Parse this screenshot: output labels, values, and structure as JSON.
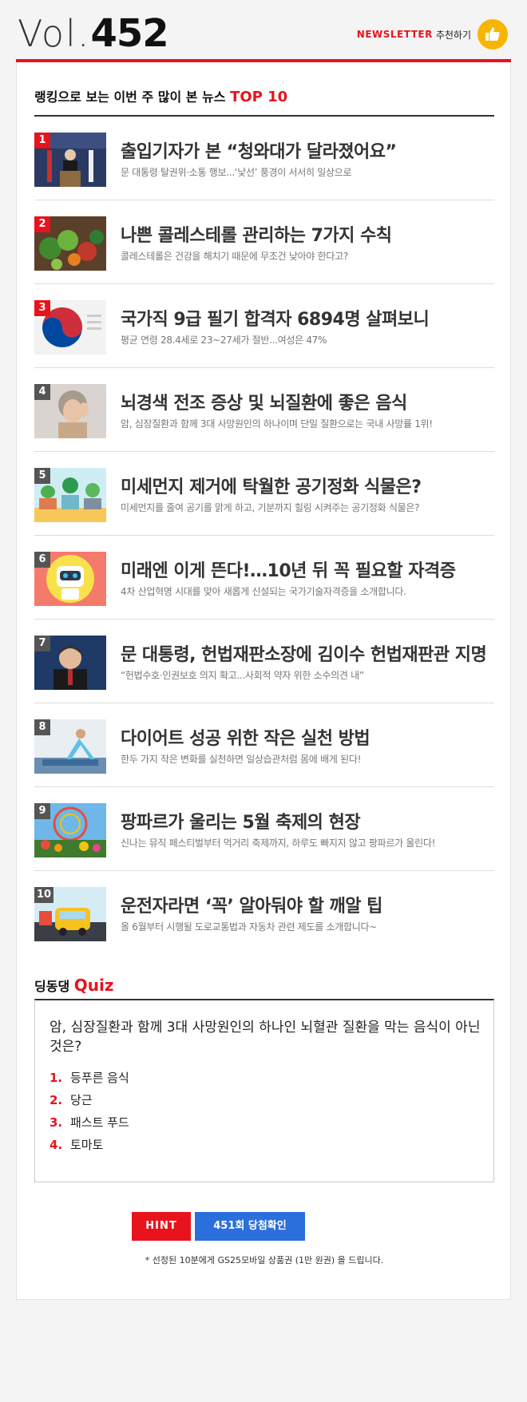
{
  "header": {
    "vol_label": "Vol.",
    "vol_number": "452",
    "newsletter_label": "NEWSLETTER",
    "recommend_label": "추천하기"
  },
  "ranking": {
    "title_prefix": "랭킹으로 보는 이번 주 많이 본 뉴스",
    "title_accent": "TOP 10",
    "items": [
      {
        "rank": "1",
        "title": "출입기자가 본 “청와대가 달라졌어요”",
        "subtitle": "문 대통령 탈권위·소통 행보...‘낯선’ 풍경이 서서히 일상으로",
        "thumb": "press-briefing-image"
      },
      {
        "rank": "2",
        "title": "나쁜 콜레스테롤 관리하는 7가지 수칙",
        "subtitle": "콜레스테롤은 건강을 해치기 때문에 무조건 낮아야 한다고?",
        "thumb": "vegetables-image"
      },
      {
        "rank": "3",
        "title": "국가직 9급 필기 합격자 6894명 살펴보니",
        "subtitle": "평균 연령 28.4세로 23~27세가 절반...여성은 47%",
        "thumb": "taegeuk-image"
      },
      {
        "rank": "4",
        "title": "뇌경색 전조 증상 및 뇌질환에 좋은 음식",
        "subtitle": "암, 심장질환과 함께 3대 사망원인의 하나이며 단일 질환으로는 국내 사망률 1위!",
        "thumb": "headache-image"
      },
      {
        "rank": "5",
        "title": "미세먼지 제거에 탁월한 공기정화 식물은?",
        "subtitle": "미세먼지를 줄여 공기를 맑게 하고, 기분까지 힐링 시켜주는 공기정화 식물은?",
        "thumb": "plants-image"
      },
      {
        "rank": "6",
        "title": "미래엔 이게 뜬다!…10년 뒤 꼭 필요할 자격증",
        "subtitle": "4차 산업혁명 시대를 맞아 새롭게 신설되는 국가기술자격증을 소개합니다.",
        "thumb": "robot-image"
      },
      {
        "rank": "7",
        "title": "문 대통령, 헌법재판소장에 김이수 헌법재판관 지명",
        "subtitle": "“헌법수호·인권보호 의지 확고...사회적 약자 위한 소수의견 내”",
        "thumb": "president-image"
      },
      {
        "rank": "8",
        "title": "다이어트 성공 위한 작은 실천 방법",
        "subtitle": "한두 가지 작은 변화를 실천하면 일상습관처럼 몸에 배게 된다!",
        "thumb": "yoga-image"
      },
      {
        "rank": "9",
        "title": "팡파르가 울리는 5월 축제의 현장",
        "subtitle": "신나는 뮤직 페스티벌부터 먹거리 축제까지, 하루도 빠지지 않고 팡파르가 울린다!",
        "thumb": "festival-image"
      },
      {
        "rank": "10",
        "title": "운전자라면 ‘꼭’ 알아둬야 할 깨알 팁",
        "subtitle": " 올 6월부터 시행될 도로교통법과 자동차 관련 제도를 소개합니다~",
        "thumb": "car-image"
      }
    ]
  },
  "quiz": {
    "title_prefix": "딩동댕",
    "title_accent": "Quiz",
    "question": "암, 심장질환과 함께 3대 사망원인의 하나인 뇌혈관 질환을 막는 음식이 아닌 것은?",
    "options": [
      {
        "num": "1.",
        "label": "등푸른 음식"
      },
      {
        "num": "2.",
        "label": "당근"
      },
      {
        "num": "3.",
        "label": "패스트 푸드"
      },
      {
        "num": "4.",
        "label": "토마토"
      }
    ],
    "hint_label": "HINT",
    "check_label": "451회 당첨확인",
    "prize_note": "* 선정된 10분에게 GS25모바일 상품권 (1만 원권) 을 드립니다."
  },
  "colors": {
    "accent_red": "#e8131d",
    "button_blue": "#2a6fdc",
    "thumb_yellow": "#f7b500"
  }
}
